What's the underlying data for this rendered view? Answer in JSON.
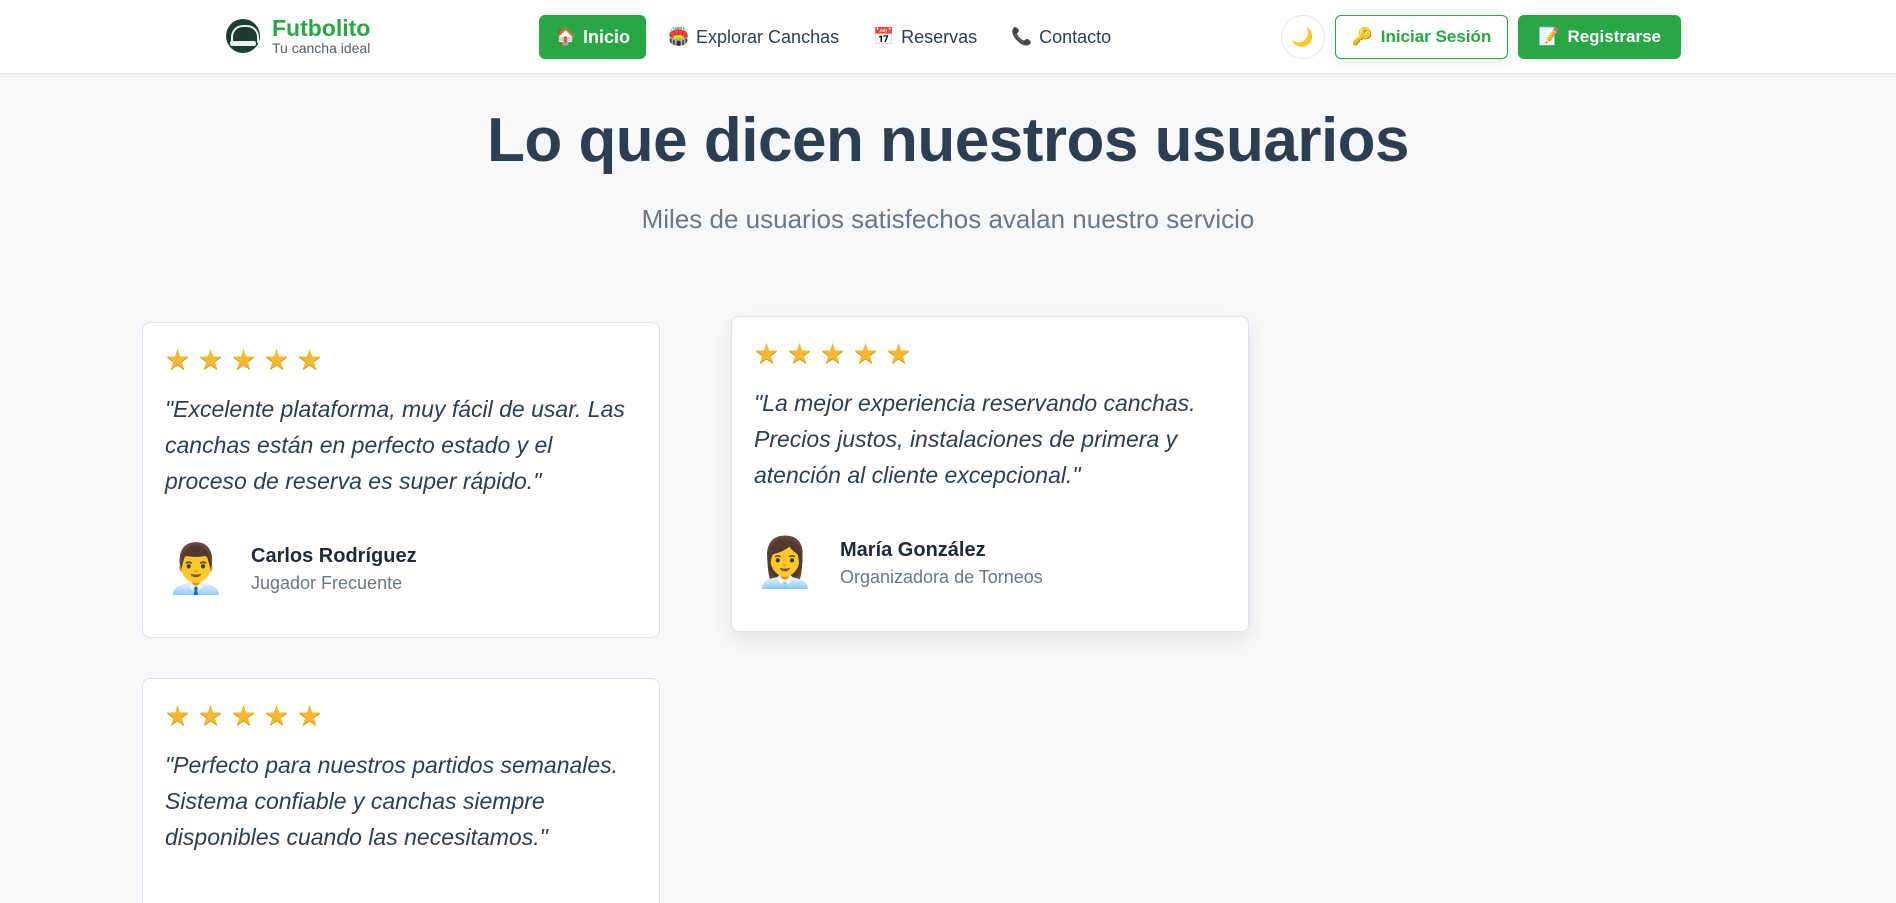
{
  "brand": {
    "name": "Futbolito",
    "tagline": "Tu cancha ideal",
    "logo_icon": "stadium-icon",
    "color": "#28a745"
  },
  "nav": {
    "items": [
      {
        "label": "Inicio",
        "icon": "🏠",
        "active": true
      },
      {
        "label": "Explorar Canchas",
        "icon": "🏟️",
        "active": false
      },
      {
        "label": "Reservas",
        "icon": "📅",
        "active": false
      },
      {
        "label": "Contacto",
        "icon": "📞",
        "active": false
      }
    ]
  },
  "actions": {
    "theme_icon": "🌙",
    "login": {
      "label": "Iniciar Sesión",
      "icon": "🔑"
    },
    "register": {
      "label": "Registrarse",
      "icon": "📝"
    }
  },
  "section": {
    "title": "Lo que dicen nuestros usuarios",
    "subtitle": "Miles de usuarios satisfechos avalan nuestro servicio"
  },
  "testimonials": [
    {
      "rating": 5,
      "quote": "\"Excelente plataforma, muy fácil de usar. Las canchas están en perfecto estado y el proceso de reserva es super rápido.\"",
      "avatar": "👨‍💼",
      "name": "Carlos Rodríguez",
      "role": "Jugador Frecuente"
    },
    {
      "rating": 5,
      "quote": "\"La mejor experiencia reservando canchas. Precios justos, instalaciones de primera y atención al cliente excepcional.\"",
      "avatar": "👩‍💼",
      "name": "María González",
      "role": "Organizadora de Torneos"
    },
    {
      "rating": 5,
      "quote": "\"Perfecto para nuestros partidos semanales. Sistema confiable y canchas siempre disponibles cuando las necesitamos.\""
    }
  ]
}
